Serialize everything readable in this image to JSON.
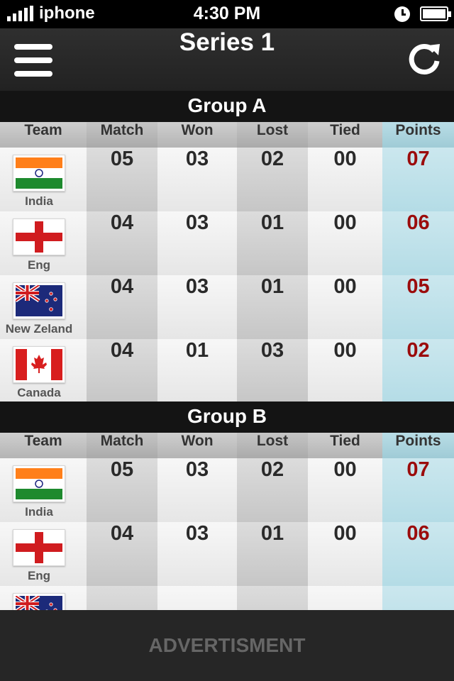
{
  "status_bar": {
    "carrier": "iphone",
    "time": "4:30 PM"
  },
  "nav": {
    "title": "Series 1",
    "menu_icon": "hamburger-menu-icon",
    "refresh_icon": "refresh-icon"
  },
  "columns": [
    "Team",
    "Match",
    "Won",
    "Lost",
    "Tied",
    "Points"
  ],
  "groups": [
    {
      "title": "Group A",
      "rows": [
        {
          "team": "India",
          "flag": "india",
          "match": "05",
          "won": "03",
          "lost": "02",
          "tied": "00",
          "points": "07"
        },
        {
          "team": "Eng",
          "flag": "england",
          "match": "04",
          "won": "03",
          "lost": "01",
          "tied": "00",
          "points": "06"
        },
        {
          "team": "New Zeland",
          "flag": "new-zealand",
          "match": "04",
          "won": "03",
          "lost": "01",
          "tied": "00",
          "points": "05"
        },
        {
          "team": "Canada",
          "flag": "canada",
          "match": "04",
          "won": "01",
          "lost": "03",
          "tied": "00",
          "points": "02"
        }
      ]
    },
    {
      "title": "Group B",
      "rows": [
        {
          "team": "India",
          "flag": "india",
          "match": "05",
          "won": "03",
          "lost": "02",
          "tied": "00",
          "points": "07"
        },
        {
          "team": "Eng",
          "flag": "england",
          "match": "04",
          "won": "03",
          "lost": "01",
          "tied": "00",
          "points": "06"
        },
        {
          "team": "",
          "flag": "new-zealand",
          "match": "",
          "won": "",
          "lost": "",
          "tied": "",
          "points": ""
        }
      ]
    }
  ],
  "footer": {
    "ad_label": "ADVERTISMENT"
  },
  "colors": {
    "points_text": "#9b0c0c",
    "points_bg": "#c4e3ea",
    "header_bg": "#141414"
  }
}
